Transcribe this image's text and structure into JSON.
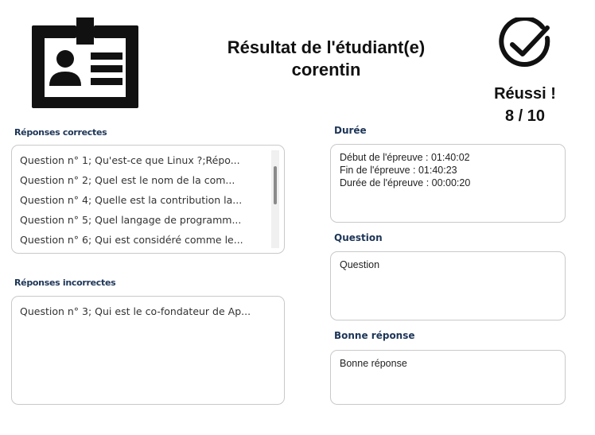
{
  "header": {
    "title_line1": "Résultat de l'étudiant(e)",
    "student_name": "corentin",
    "status": "Réussi !",
    "score": "8 / 10"
  },
  "icons": {
    "badge": "id-card-icon",
    "check": "check-circle-icon"
  },
  "correct": {
    "label": "Réponses correctes",
    "items": [
      "Question n° 1; Qu'est-ce que Linux ?;Répo...",
      "Question n° 2; Quel est le nom de la com...",
      "Question n° 4; Quelle est la contribution la...",
      "Question n° 5; Quel langage de programm...",
      "Question n° 6; Qui est considéré comme le..."
    ]
  },
  "incorrect": {
    "label": "Réponses incorrectes",
    "items": [
      "Question n° 3; Qui est le co-fondateur de Ap..."
    ]
  },
  "duration": {
    "label": "Durée",
    "lines": [
      "Début de l'épreuve : 01:40:02",
      "Fin de l'épreuve : 01:40:23",
      "Durée de l'épreuve : 00:00:20"
    ]
  },
  "question": {
    "label": "Question",
    "value": "Question"
  },
  "answer": {
    "label": "Bonne réponse",
    "value": "Bonne réponse"
  }
}
